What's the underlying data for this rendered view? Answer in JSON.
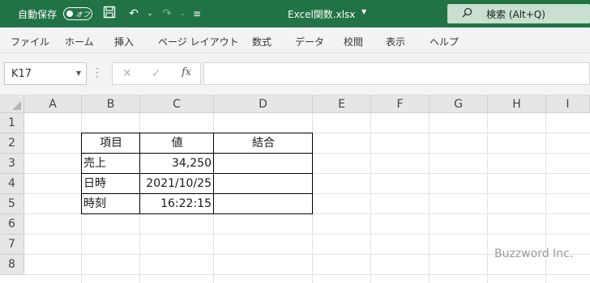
{
  "titlebar": {
    "autosave_label": "自動保存",
    "autosave_state": "オフ",
    "filename": "Excel関数.xlsx",
    "search_label": "検索 (Alt+Q)",
    "icons": [
      "save-icon",
      "undo-icon",
      "redo-icon",
      "customize-qat-icon",
      "search-icon"
    ],
    "accent_color": "#217346"
  },
  "ribbon": {
    "tabs": [
      "ファイル",
      "ホーム",
      "挿入",
      "ページ レイアウト",
      "数式",
      "データ",
      "校閲",
      "表示",
      "ヘルプ"
    ]
  },
  "formula_bar": {
    "name_box": "K17",
    "cancel_glyph": "✕",
    "enter_glyph": "✓",
    "fx_label": "fx",
    "formula": ""
  },
  "sheet": {
    "columns": [
      "A",
      "B",
      "C",
      "D",
      "E",
      "F",
      "G",
      "H",
      "I"
    ],
    "rows": [
      "1",
      "2",
      "3",
      "4",
      "5",
      "6",
      "7",
      "8"
    ],
    "cells": {
      "B2": "項目",
      "C2": "値",
      "D2": "結合",
      "B3": "売上",
      "C3": "34,250",
      "B4": "日時",
      "C4": "2021/10/25",
      "B5": "時刻",
      "C5": "16:22:15"
    }
  },
  "watermark": "Buzzword Inc."
}
